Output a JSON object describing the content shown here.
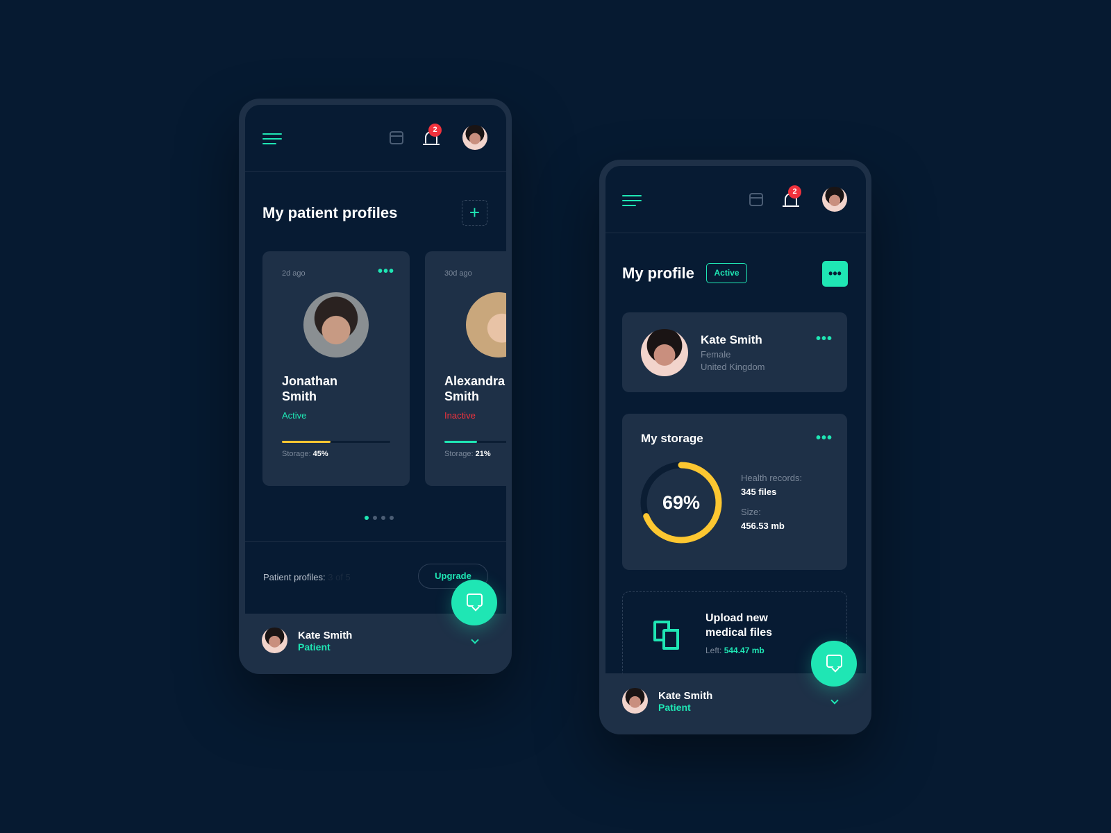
{
  "colors": {
    "background": "#061a31",
    "accent": "#1fe6b4",
    "warning": "#fdc731",
    "danger": "#f0323d",
    "card": "#1e3047"
  },
  "header": {
    "notification_count": "2",
    "icons": [
      "menu-icon",
      "calendar-icon",
      "bell-icon",
      "avatar"
    ]
  },
  "left_screen": {
    "title": "My patient profiles",
    "add_label": "+",
    "patients": [
      {
        "time": "2d ago",
        "first_name": "Jonathan",
        "last_name": "Smith",
        "status": "Active",
        "storage_label": "Storage:",
        "storage_value": "45%",
        "storage_percent": 45
      },
      {
        "time": "30d ago",
        "first_name": "Alexandra",
        "last_name": "Smith",
        "status": "Inactive",
        "storage_label": "Storage:",
        "storage_value": "21%",
        "storage_percent": 21
      }
    ],
    "pagination": {
      "pages": 4,
      "current": 1
    },
    "profiles_label": "Patient profiles:",
    "profiles_count": "3 of 5",
    "upgrade_label": "Upgrade"
  },
  "right_screen": {
    "title": "My profile",
    "status": "Active",
    "profile": {
      "name": "Kate Smith",
      "gender": "Female",
      "country": "United Kingdom"
    },
    "storage": {
      "title": "My storage",
      "percent": 69,
      "percent_label": "69%",
      "records_label": "Health records:",
      "records_value": "345 files",
      "size_label": "Size:",
      "size_value": "456.53 mb"
    },
    "upload": {
      "line1": "Upload new",
      "line2": "medical files",
      "left_label": "Left:",
      "left_value": "544.47 mb"
    }
  },
  "user": {
    "name": "Kate Smith",
    "role": "Patient"
  }
}
